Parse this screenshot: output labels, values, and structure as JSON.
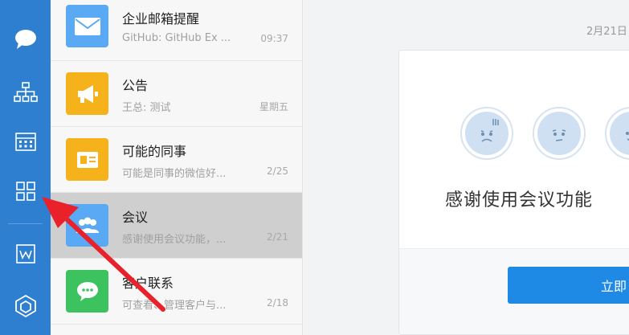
{
  "rail": {
    "items": [
      {
        "name": "messages",
        "icon": "chat-bubble-icon"
      },
      {
        "name": "org",
        "icon": "org-chart-icon"
      },
      {
        "name": "calendar",
        "icon": "calendar-icon"
      },
      {
        "name": "workbench",
        "icon": "apps-grid-icon"
      },
      {
        "name": "wedrive",
        "icon": "document-w-icon"
      },
      {
        "name": "hexagon",
        "icon": "hexagon-icon"
      }
    ]
  },
  "conversations": [
    {
      "title": "企业邮箱提醒",
      "subtitle": "GitHub: GitHub Ex ...",
      "time": "09:37",
      "icon": "mail-icon",
      "color": "#5aa9f5"
    },
    {
      "title": "公告",
      "subtitle": "王总: 测试",
      "time": "星期五",
      "icon": "megaphone-icon",
      "color": "#f6b21a"
    },
    {
      "title": "可能的同事",
      "subtitle": "可能是同事的微信好...",
      "time": "2/25",
      "icon": "contact-card-icon",
      "color": "#f6b21a"
    },
    {
      "title": "会议",
      "subtitle": "感谢使用会议功能，...",
      "time": "2/21",
      "icon": "people-icon",
      "color": "#5aa9f5",
      "active": true
    },
    {
      "title": "客户联系",
      "subtitle": "可查看、管理客户与...",
      "time": "2/18",
      "icon": "wechat-bubble-icon",
      "color": "#3cc35f"
    }
  ],
  "main": {
    "date": "2月21日",
    "card_title": "感谢使用会议功能",
    "button_label": "立即"
  },
  "colors": {
    "rail": "#2f7fd1",
    "accent": "#1e8ae6",
    "annotation": "#e8212a"
  }
}
